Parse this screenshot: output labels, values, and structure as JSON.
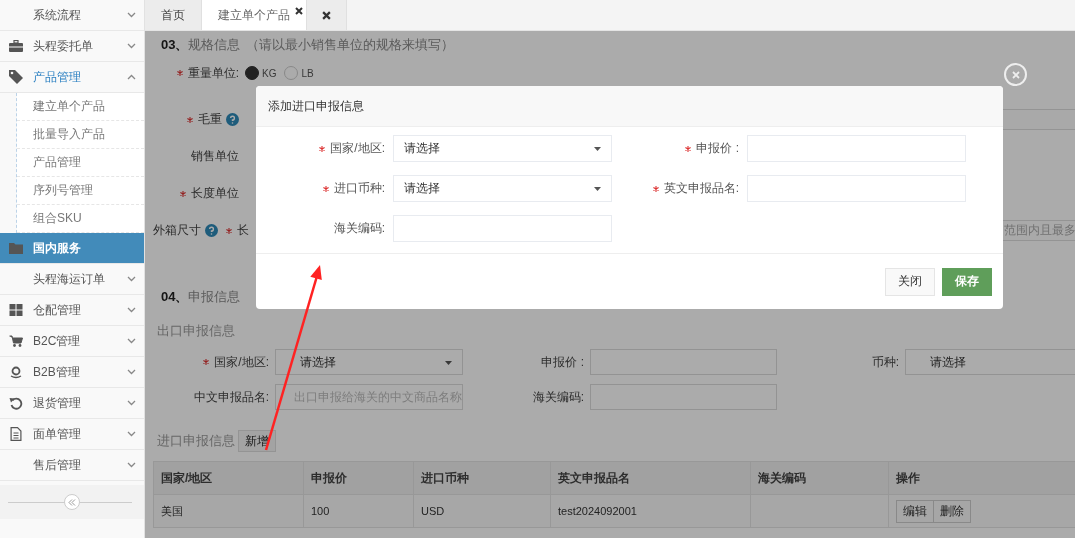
{
  "sidebar": {
    "items": [
      {
        "label": "系统流程",
        "kind": "group",
        "expanded": false,
        "selected": false
      },
      {
        "label": "头程委托单",
        "kind": "group",
        "expanded": false,
        "selected": false
      },
      {
        "label": "产品管理",
        "kind": "group",
        "expanded": true,
        "selected": false,
        "children": [
          {
            "label": "建立单个产品",
            "selected": false
          },
          {
            "label": "批量导入产品",
            "selected": false
          },
          {
            "label": "产品管理",
            "selected": false
          },
          {
            "label": "序列号管理",
            "selected": false
          },
          {
            "label": "组合SKU",
            "selected": false
          }
        ]
      },
      {
        "label": "国内服务",
        "kind": "link",
        "expanded": false,
        "selected": true
      },
      {
        "label": "头程海运订单",
        "kind": "group",
        "expanded": false,
        "selected": false
      },
      {
        "label": "仓配管理",
        "kind": "group",
        "expanded": false,
        "selected": false
      },
      {
        "label": "B2C管理",
        "kind": "group",
        "expanded": false,
        "selected": false
      },
      {
        "label": "B2B管理",
        "kind": "group",
        "expanded": false,
        "selected": false
      },
      {
        "label": "退货管理",
        "kind": "group",
        "expanded": false,
        "selected": false
      },
      {
        "label": "面单管理",
        "kind": "group",
        "expanded": false,
        "selected": false
      },
      {
        "label": "售后管理",
        "kind": "group",
        "expanded": false,
        "selected": false
      }
    ]
  },
  "tabs": [
    {
      "label": "首页",
      "selected": false,
      "closable": false
    },
    {
      "label": "建立单个产品",
      "selected": true,
      "closable": true
    },
    {
      "selected": false,
      "closable": true
    }
  ],
  "spec": {
    "number": "03、",
    "title": "规格信息",
    "note": "（请以最小销售单位的规格来填写）",
    "weight_unit": {
      "label": "重量单位:",
      "required": true,
      "options": [
        {
          "label": "KG",
          "selected": true
        },
        {
          "label": "LB",
          "selected": false
        }
      ]
    },
    "rows": [
      {
        "label": "毛重",
        "required": true,
        "help": true,
        "right_field": true
      },
      {
        "label": "销售单位",
        "required": false,
        "help": false,
        "right_field": false
      },
      {
        "label": "长度单位",
        "required": true,
        "help": false,
        "right_field": false
      }
    ],
    "box_row": {
      "label": "外箱尺寸",
      "sub_label": "长",
      "sub_required": true,
      "right_placeholder": "范围内且最多"
    }
  },
  "declare": {
    "number": "04、",
    "title": "申报信息",
    "export": {
      "title": "出口申报信息",
      "fields": [
        {
          "label": "国家/地区:",
          "required": true,
          "kind": "select",
          "value": "请选择"
        },
        {
          "label": "申报价 :",
          "required": false,
          "kind": "input"
        },
        {
          "label": "币种:",
          "required": false,
          "kind": "select",
          "value": "请选择"
        },
        {
          "label": "中文申报品名:",
          "required": false,
          "kind": "input",
          "placeholder": "出口申报给海关的中文商品名称"
        },
        {
          "label": "海关编码:",
          "required": false,
          "kind": "input"
        }
      ]
    },
    "import": {
      "title": "进口申报信息",
      "add_button": "新增"
    },
    "table": {
      "columns": [
        "国家/地区",
        "申报价",
        "进口币种",
        "英文申报品名",
        "海关编码",
        "操作"
      ],
      "rows": [
        {
          "country": "美国",
          "price": "100",
          "currency": "USD",
          "name_en": "test2024092001",
          "actions": [
            "编辑",
            "删除"
          ]
        }
      ]
    }
  },
  "modal": {
    "title": "添加进口申报信息",
    "fields": [
      {
        "label": "国家/地区:",
        "required": true,
        "kind": "select",
        "value": "请选择"
      },
      {
        "label": "申报价 :",
        "required": true,
        "kind": "input"
      },
      {
        "label": "进口币种:",
        "required": true,
        "kind": "select",
        "value": "请选择"
      },
      {
        "label": "英文申报品名:",
        "required": true,
        "kind": "input"
      },
      {
        "label": "海关编码:",
        "required": false,
        "kind": "input"
      }
    ],
    "buttons": [
      {
        "label": "关闭",
        "kind": "default"
      },
      {
        "label": "保存",
        "kind": "primary"
      }
    ]
  }
}
